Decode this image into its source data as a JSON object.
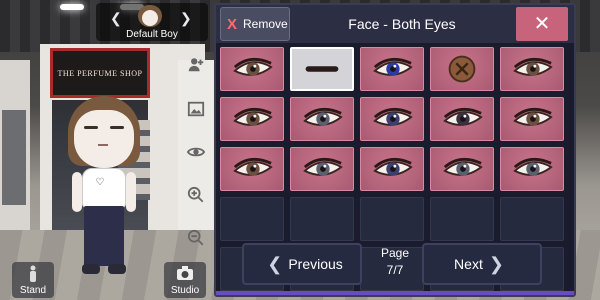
{
  "scene": {
    "shop_sign": "THE PERFUME SHOP"
  },
  "preset": {
    "name": "Default Boy",
    "prev_icon": "chevron-left-icon",
    "next_icon": "chevron-right-icon"
  },
  "tools": [
    "add-person-icon",
    "image-icon",
    "eye-icon",
    "zoom-in-icon",
    "zoom-out-icon"
  ],
  "bottom_buttons": {
    "stand_label": "Stand",
    "studio_label": "Studio"
  },
  "panel": {
    "remove_label": "Remove",
    "remove_icon": "X",
    "title": "Face - Both Eyes",
    "close_icon": "✕"
  },
  "grid": {
    "rows": 5,
    "cols": 5,
    "filled_count": 15,
    "selected_index": 1,
    "items": [
      {
        "type": "eye",
        "iris": "#6a5040"
      },
      {
        "type": "closed"
      },
      {
        "type": "eye",
        "iris": "#2a3ca0"
      },
      {
        "type": "button"
      },
      {
        "type": "eye",
        "iris": "#6a5040"
      },
      {
        "type": "eye",
        "iris": "#6a5040"
      },
      {
        "type": "eye",
        "iris": "#5a6070"
      },
      {
        "type": "eye",
        "iris": "#3a4070"
      },
      {
        "type": "eye",
        "iris": "#3a3040"
      },
      {
        "type": "eye",
        "iris": "#6a5040"
      },
      {
        "type": "eye",
        "iris": "#6a5040"
      },
      {
        "type": "eye",
        "iris": "#5a6070"
      },
      {
        "type": "eye",
        "iris": "#3a4070"
      },
      {
        "type": "eye",
        "iris": "#5a6070"
      },
      {
        "type": "eye",
        "iris": "#5a6070"
      }
    ]
  },
  "pagination": {
    "prev_label": "Previous",
    "next_label": "Next",
    "page_label": "Page",
    "page_value": "7/7"
  },
  "colors": {
    "accent": "#c7647c",
    "panel_bg": "#1a1c2e",
    "cell_pink": "#b8657c"
  }
}
